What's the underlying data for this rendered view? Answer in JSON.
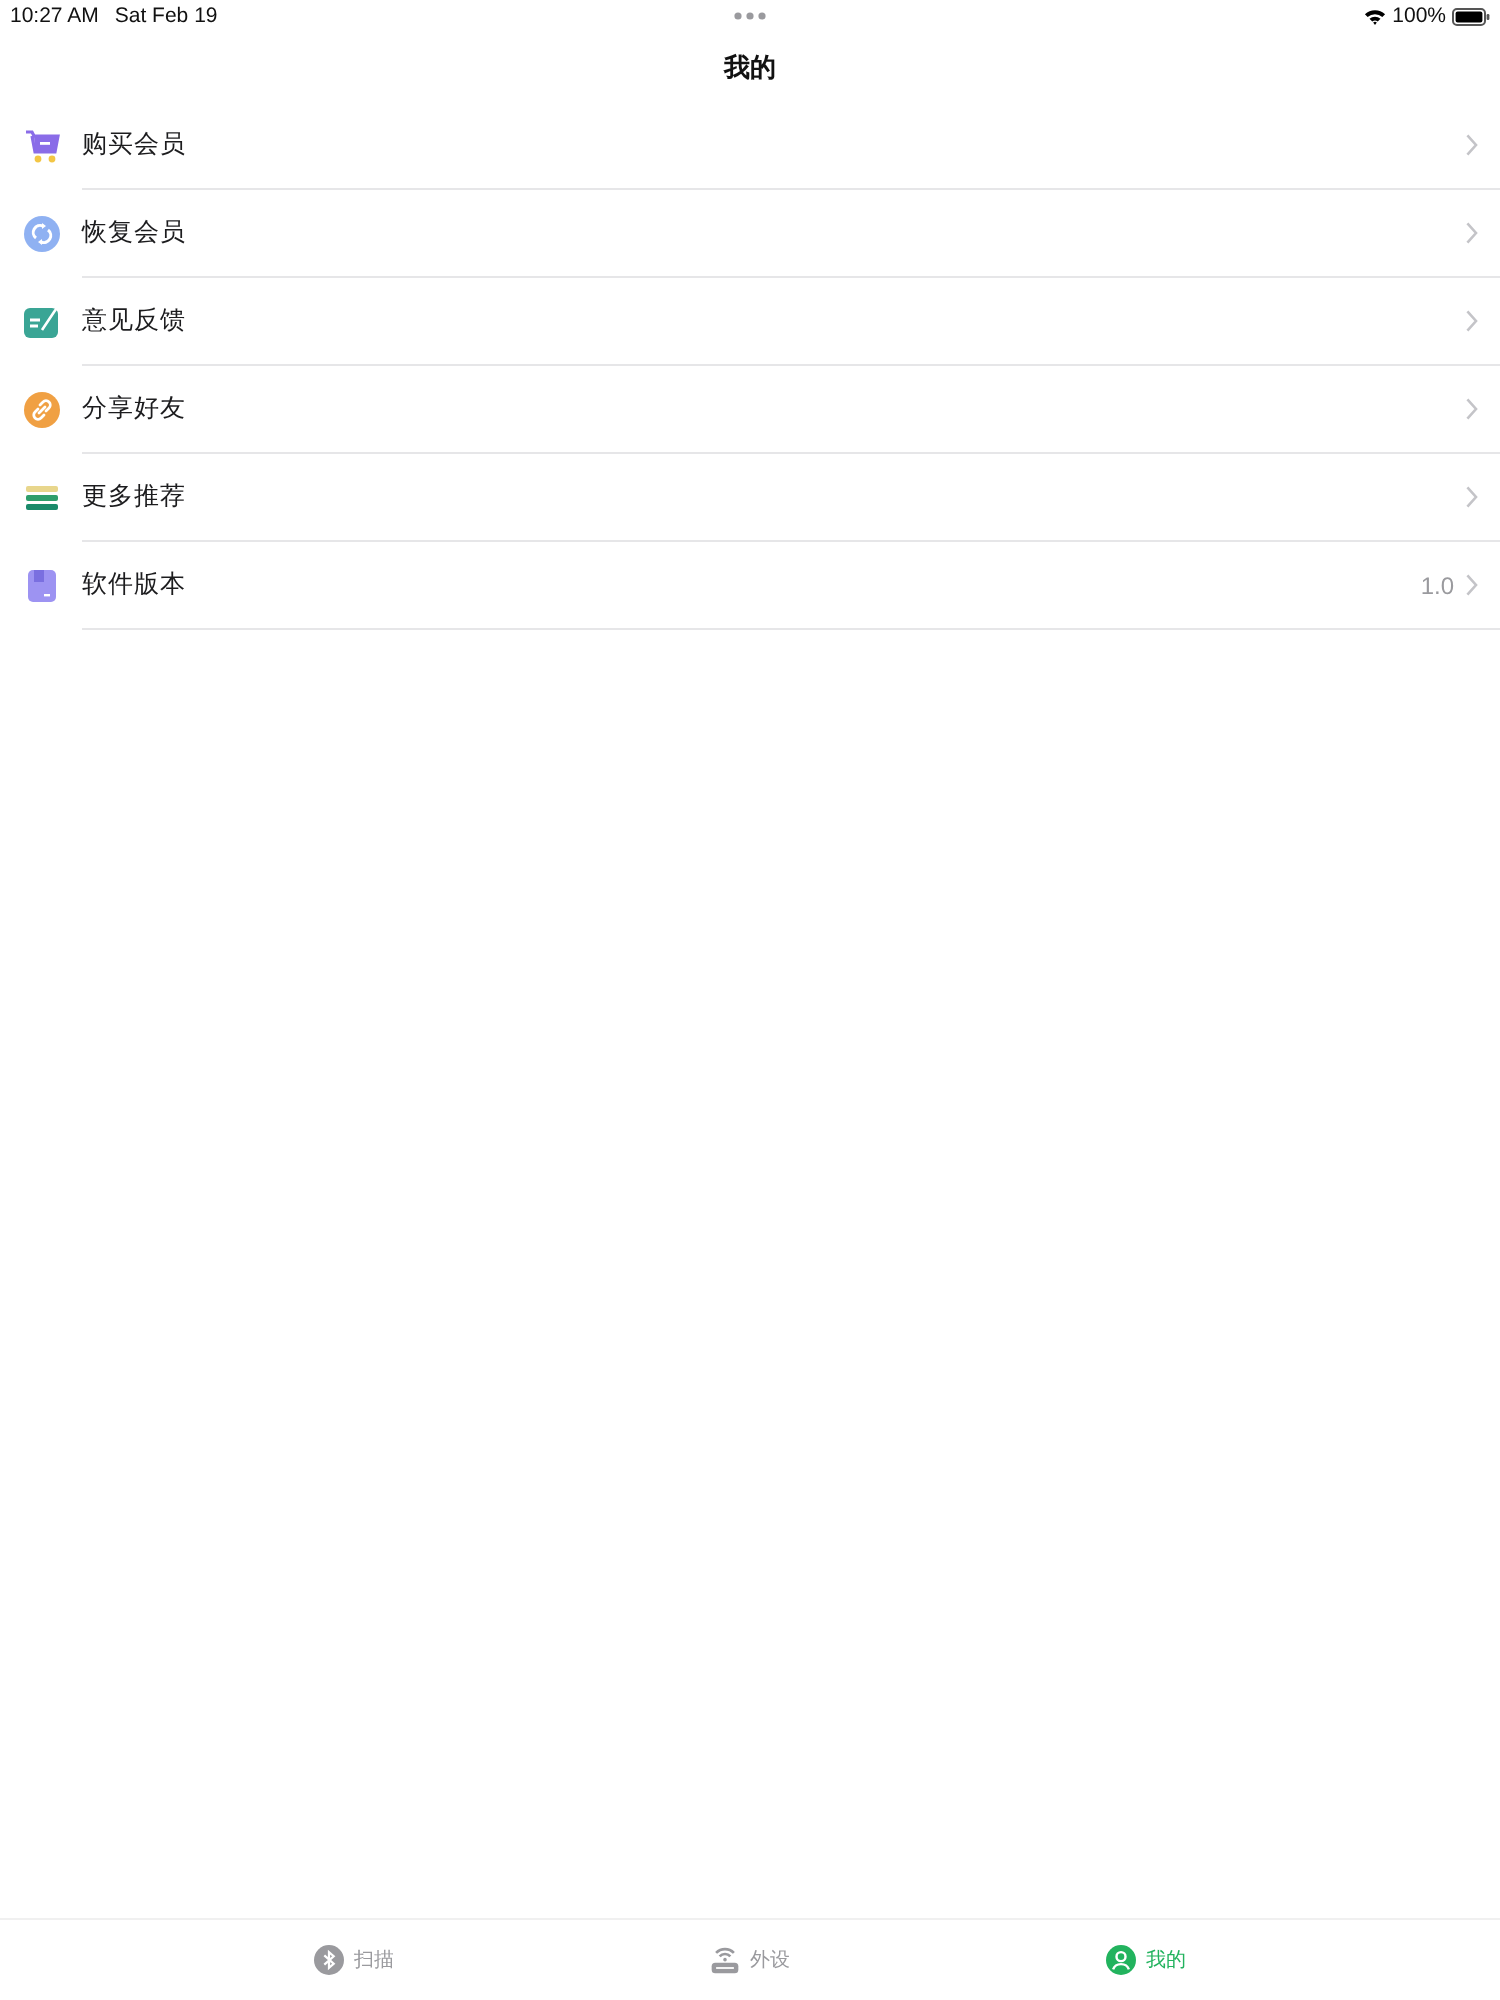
{
  "status_bar": {
    "time": "10:27 AM",
    "date": "Sat Feb 19",
    "battery": "100%"
  },
  "nav_bar": {
    "title": "我的"
  },
  "menu_items": [
    {
      "label": "购买会员",
      "kind": "cart"
    },
    {
      "label": "恢复会员",
      "kind": "restore"
    },
    {
      "label": "意见反馈",
      "kind": "feedback"
    },
    {
      "label": "分享好友",
      "kind": "share"
    },
    {
      "label": "更多推荐",
      "kind": "more"
    },
    {
      "label": "软件版本",
      "kind": "version",
      "value": "1.0"
    }
  ],
  "tab_bar": [
    {
      "label": "扫描",
      "kind": "bluetooth",
      "selected": false
    },
    {
      "label": "外设",
      "kind": "router",
      "selected": false
    },
    {
      "label": "我的",
      "kind": "person",
      "selected": true
    }
  ]
}
